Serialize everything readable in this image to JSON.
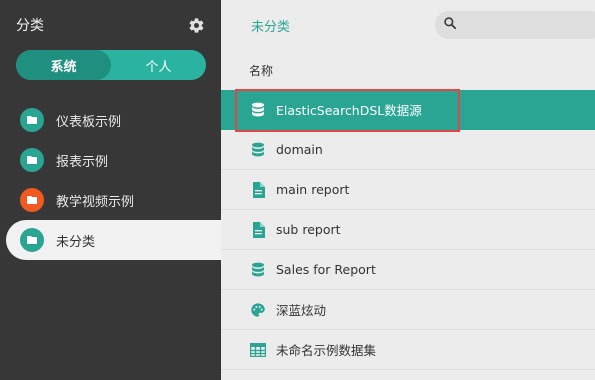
{
  "sidebar": {
    "title": "分类",
    "tabs": [
      {
        "label": "系统",
        "active": true
      },
      {
        "label": "个人",
        "active": false
      }
    ],
    "categories": [
      {
        "label": "仪表板示例",
        "color": "#2aa594"
      },
      {
        "label": "报表示例",
        "color": "#2aa594"
      },
      {
        "label": "教学视频示例",
        "color": "#f05a22"
      },
      {
        "label": "未分类",
        "color": "#2aa594",
        "selected": true
      }
    ]
  },
  "main": {
    "breadcrumb": "未分类",
    "search": {
      "placeholder": ""
    },
    "column_header": "名称",
    "items": [
      {
        "label": "ElasticSearchDSL数据源",
        "icon": "database-icon",
        "selected": true
      },
      {
        "label": "domain",
        "icon": "database-icon"
      },
      {
        "label": "main report",
        "icon": "report-file-icon"
      },
      {
        "label": "sub report",
        "icon": "report-file-icon"
      },
      {
        "label": "Sales for Report",
        "icon": "database-icon"
      },
      {
        "label": "深蓝炫动",
        "icon": "palette-icon"
      },
      {
        "label": "未命名示例数据集",
        "icon": "table-grid-icon"
      }
    ]
  },
  "colors": {
    "accent": "#2aa594",
    "sidebar_bg": "#373737",
    "highlight": "#e04848"
  }
}
